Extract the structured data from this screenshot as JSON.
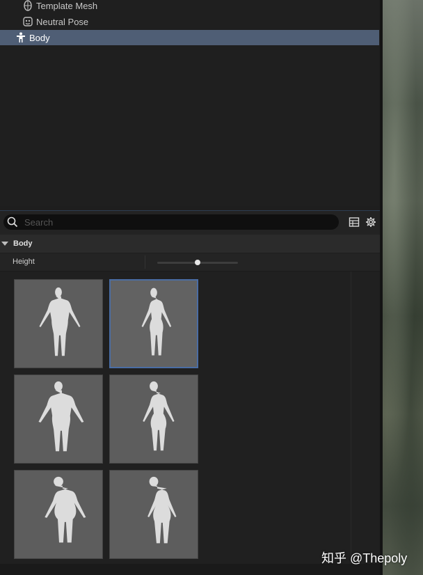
{
  "tree": {
    "items": [
      {
        "label": "Template Mesh",
        "icon": "template-mesh-icon"
      },
      {
        "label": "Neutral Pose",
        "icon": "neutral-pose-icon"
      },
      {
        "label": "Body",
        "icon": "body-icon",
        "selected": true
      }
    ]
  },
  "search": {
    "placeholder": "Search",
    "value": ""
  },
  "toolbar": {
    "table_icon": "table-view-icon",
    "settings_icon": "gear-icon"
  },
  "category": {
    "label": "Body"
  },
  "property": {
    "label": "Height",
    "slider_value": 0.5
  },
  "presets": {
    "items": [
      {
        "type": "slim-male",
        "selected": false
      },
      {
        "type": "slim-female",
        "selected": true
      },
      {
        "type": "average-male",
        "selected": false
      },
      {
        "type": "average-female",
        "selected": false
      },
      {
        "type": "heavy-male",
        "selected": false
      },
      {
        "type": "heavy-female",
        "selected": false
      }
    ]
  },
  "colors": {
    "selection": "#4f5e75",
    "accent": "#4a6da4"
  },
  "watermark": "知乎 @Thepoly"
}
